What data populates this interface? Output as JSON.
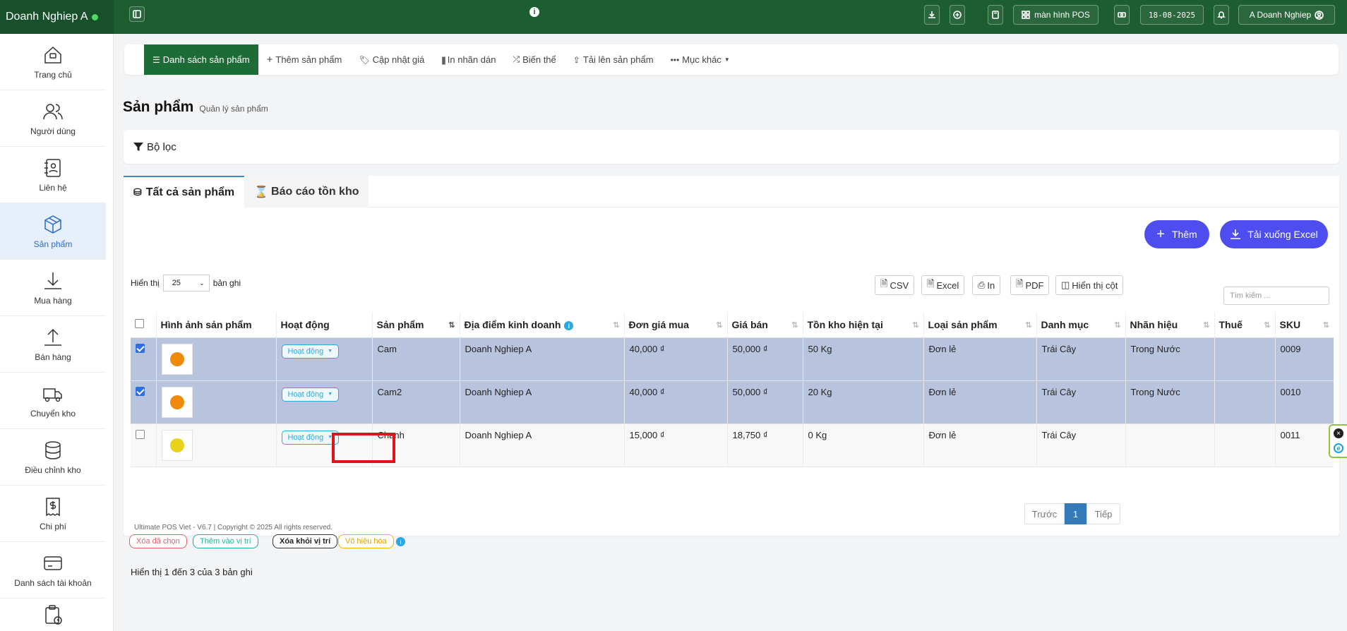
{
  "topbar": {
    "brand": "Doanh Nghiep A",
    "pos_label": "màn hình POS",
    "date": "18-08-2025",
    "user": "A Doanh Nghiep",
    "accent": "#1d5e30"
  },
  "sidebar": {
    "items": [
      {
        "label": "Trang chủ",
        "icon": "home-icon"
      },
      {
        "label": "Người dùng",
        "icon": "users-icon"
      },
      {
        "label": "Liên hệ",
        "icon": "contact-book-icon"
      },
      {
        "label": "Sản phẩm",
        "icon": "cube-icon"
      },
      {
        "label": "Mua hàng",
        "icon": "download-arrow-icon"
      },
      {
        "label": "Bán hàng",
        "icon": "upload-arrow-icon"
      },
      {
        "label": "Chuyển kho",
        "icon": "truck-icon"
      },
      {
        "label": "Điều chỉnh kho",
        "icon": "database-icon"
      },
      {
        "label": "Chi phí",
        "icon": "receipt-dollar-icon"
      },
      {
        "label": "Danh sách tài khoản",
        "icon": "card-icon"
      }
    ]
  },
  "nav": {
    "items": [
      "Danh sách sản phẩm",
      "Thêm sản phẩm",
      "Cập nhật giá",
      "In nhãn dán",
      "Biến thể",
      "Tải lên sản phẩm",
      "Mục khác"
    ]
  },
  "page": {
    "title": "Sản phẩm",
    "subtitle": "Quản lý sản phẩm",
    "filter": "Bộ lọc"
  },
  "tabs": [
    "Tất cả sản phẩm",
    "Báo cáo tồn kho"
  ],
  "actions": {
    "add": "Thêm",
    "download_excel": "Tải xuống Excel",
    "csv": "CSV",
    "excel": "Excel",
    "print": "In",
    "pdf": "PDF",
    "columns": "Hiển thị cột",
    "search_placeholder": "Tìm kiếm ..."
  },
  "entries": {
    "prefix": "Hiển thị",
    "value": "25",
    "suffix": "bản ghi"
  },
  "table": {
    "headers": [
      "Hình ảnh sản phẩm",
      "Hoạt động",
      "Sản phẩm",
      "Địa điểm kinh doanh",
      "Đơn giá mua",
      "Giá bán",
      "Tồn kho hiện tại",
      "Loại sản phẩm",
      "Danh mục",
      "Nhãn hiệu",
      "Thuế",
      "SKU"
    ],
    "rows": [
      {
        "checked": true,
        "status": "Hoạt động",
        "product": "Cam",
        "location": "Doanh Nghiep A",
        "buy": "40,000 ₫",
        "sell": "50,000 ₫",
        "stock": "50 Kg",
        "type": "Đơn lẻ",
        "category": "Trái Cây",
        "brand": "Trong Nước",
        "tax": "",
        "sku": "0009",
        "fruit_color": "#f08a0a"
      },
      {
        "checked": true,
        "status": "Hoạt động",
        "product": "Cam2",
        "location": "Doanh Nghiep A",
        "buy": "40,000 ₫",
        "sell": "50,000 ₫",
        "stock": "20 Kg",
        "type": "Đơn lẻ",
        "category": "Trái Cây",
        "brand": "Trong Nước",
        "tax": "",
        "sku": "0010",
        "fruit_color": "#f08a0a"
      },
      {
        "checked": false,
        "status": "Hoạt động",
        "product": "Chanh",
        "location": "Doanh Nghiep A",
        "buy": "15,000 ₫",
        "sell": "18,750 ₫",
        "stock": "0 Kg",
        "type": "Đơn lẻ",
        "category": "Trái Cây",
        "brand": "",
        "tax": "",
        "sku": "0011",
        "fruit_color": "#e8d21a"
      }
    ]
  },
  "bulk": {
    "delete": "Xóa đã chọn",
    "add_location": "Thêm vào vị trí",
    "remove_location": "Xóa khỏi vị trí",
    "deactivate": "Vô hiệu hóa"
  },
  "pagination": {
    "info": "Hiển thị 1 đến 3 của 3 bản ghi",
    "prev": "Trước",
    "current": "1",
    "next": "Tiếp"
  },
  "footer": "Ultimate POS Viet - V6.7 | Copyright © 2025 All rights reserved."
}
